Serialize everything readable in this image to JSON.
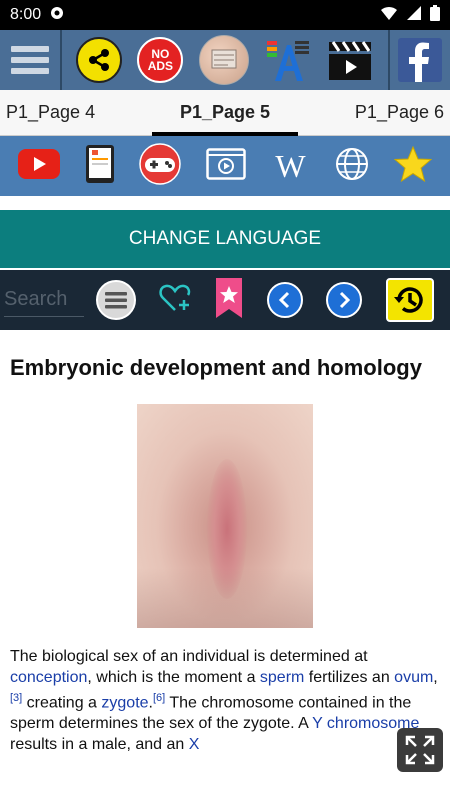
{
  "status": {
    "time": "8:00"
  },
  "tabs": [
    {
      "label": "P1_Page 4"
    },
    {
      "label": "P1_Page 5"
    },
    {
      "label": "P1_Page 6"
    }
  ],
  "toolbar": {
    "no_ads_line1": "NO",
    "no_ads_line2": "ADS"
  },
  "apps": {
    "wikipedia_glyph": "W"
  },
  "language_button": "CHANGE LANGUAGE",
  "search": {
    "placeholder": "Search"
  },
  "article": {
    "title": "Embryonic development and homology",
    "para_parts": {
      "t1": "The biological sex of an individual is determined at ",
      "l1": "conception",
      "t2": ", which is the moment a ",
      "l2": "sperm",
      "t3": " fertilizes an ",
      "l3": "ovum",
      "s1": "[3]",
      "t4": " creating a ",
      "l4": "zygote",
      "s2": "[6]",
      "t5": " The chromosome contained in the sperm determines the sex of the zygote. A ",
      "l5": "Y chromosome",
      "t6": " results in a male, and an ",
      "l6": "X"
    }
  },
  "colors": {
    "toolbar": "#4a6e96",
    "apps_bar": "#4a7db3",
    "language_bar": "#0c7e7e",
    "search_bar": "#1a2836",
    "link": "#1a3ea8"
  }
}
